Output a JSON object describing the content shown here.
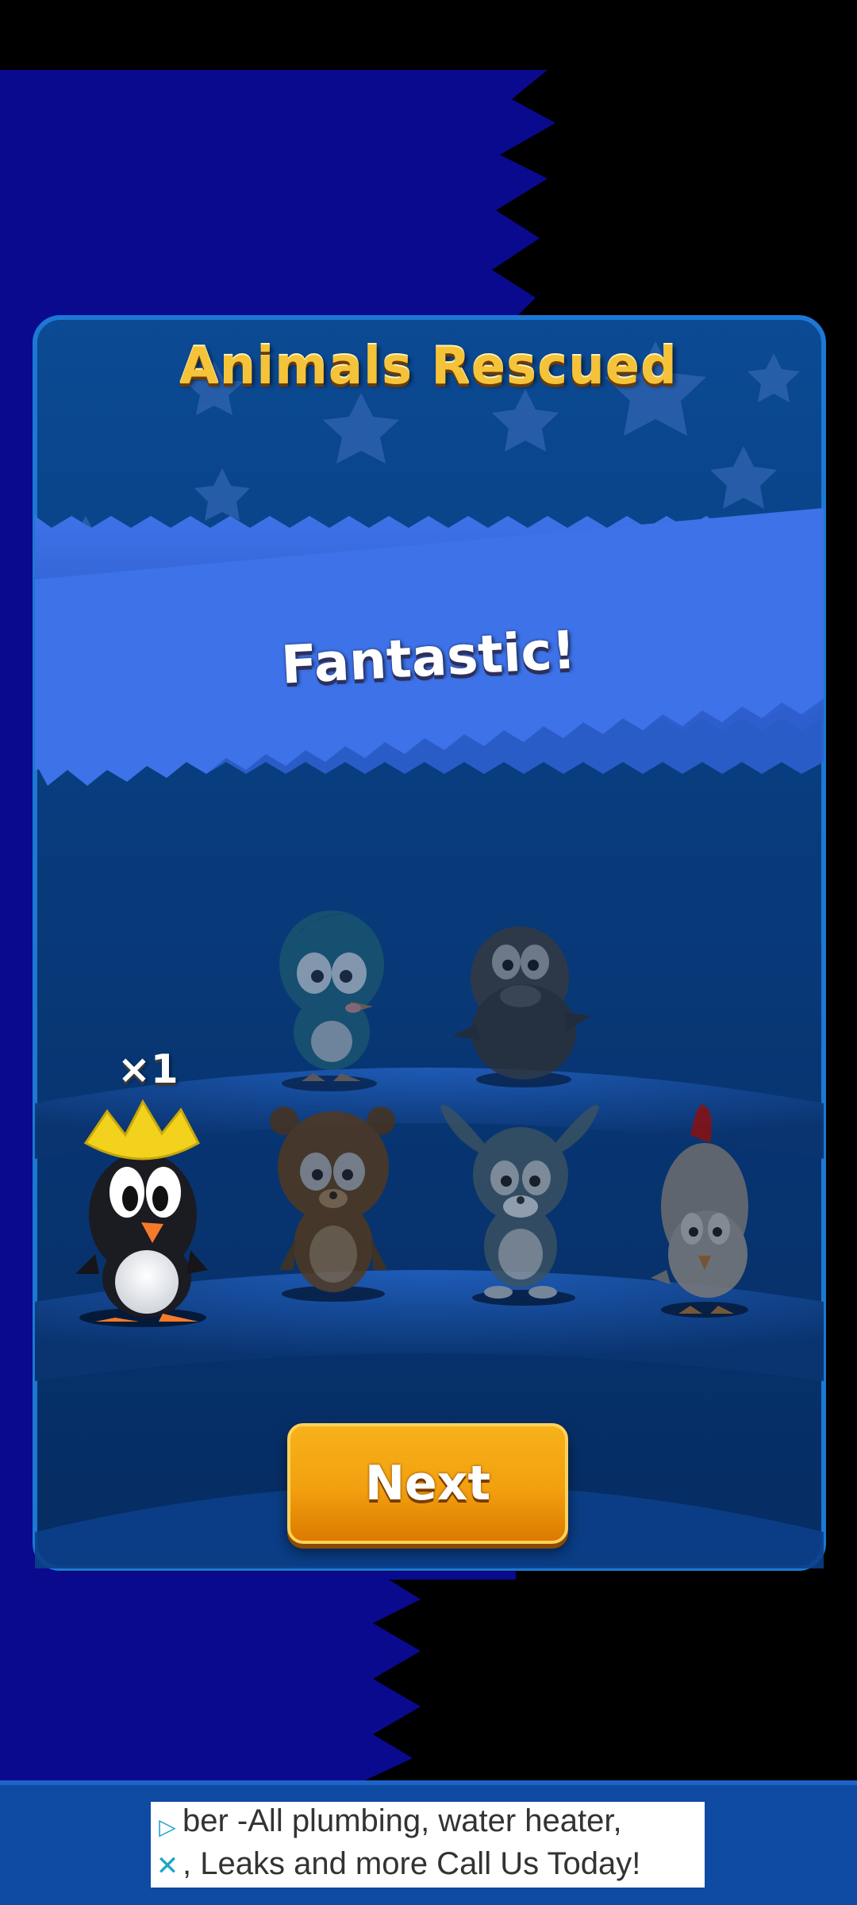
{
  "panel": {
    "title": "Animals Rescued",
    "banner_text": "Fantastic!",
    "counter": "×1",
    "next_label": "Next"
  },
  "animals": [
    {
      "name": "penguin",
      "rescued": true
    },
    {
      "name": "bear",
      "rescued": false
    },
    {
      "name": "bunny",
      "rescued": false
    },
    {
      "name": "chicken",
      "rescued": false
    },
    {
      "name": "bluebird",
      "rescued": false
    },
    {
      "name": "seal",
      "rescued": false
    }
  ],
  "ad": {
    "line1": "ber -All plumbing, water heater,",
    "line2": ", Leaks and more Call Us Today!",
    "play_icon": "adchoices-play-icon",
    "close_icon": "close-icon"
  },
  "colors": {
    "page_blue": "#0a0a8f",
    "panel_blue": "#083a7a",
    "banner_blue": "#3c6ee0",
    "title_gold": "#f5c33a",
    "button_orange": "#f2a00f",
    "ad_bar": "#0f4aa3"
  }
}
